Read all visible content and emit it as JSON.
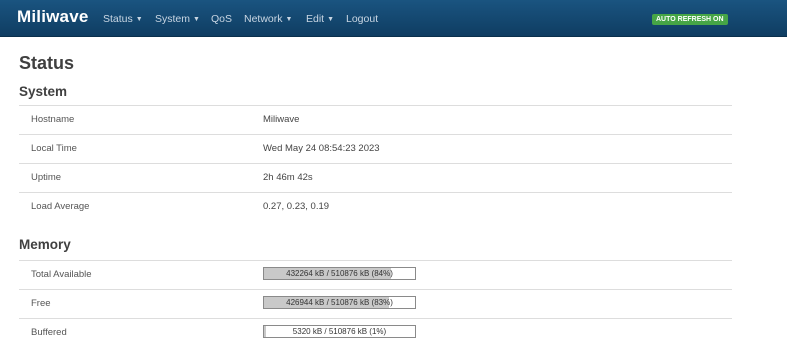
{
  "navbar": {
    "brand": "Miliwave",
    "items": [
      {
        "label": "Status",
        "dropdown": true
      },
      {
        "label": "System",
        "dropdown": true
      },
      {
        "label": "QoS",
        "dropdown": false
      },
      {
        "label": "Network",
        "dropdown": true
      },
      {
        "label": "Edit",
        "dropdown": true
      },
      {
        "label": "Logout",
        "dropdown": false
      }
    ],
    "auto_refresh_label": "AUTO REFRESH ON",
    "auto_refresh_color": "#46a546",
    "background_color": "#13466f"
  },
  "page": {
    "title": "Status"
  },
  "system": {
    "heading": "System",
    "rows": [
      {
        "label": "Hostname",
        "value": "Miliwave"
      },
      {
        "label": "Local Time",
        "value": "Wed May 24 08:54:23 2023"
      },
      {
        "label": "Uptime",
        "value": "2h 46m 42s"
      },
      {
        "label": "Load Average",
        "value": "0.27, 0.23, 0.19"
      }
    ]
  },
  "memory": {
    "heading": "Memory",
    "rows": [
      {
        "label": "Total Available",
        "bar_text": "432264 kB / 510876 kB (84%)",
        "percent": 84
      },
      {
        "label": "Free",
        "bar_text": "426944 kB / 510876 kB (83%)",
        "percent": 83
      },
      {
        "label": "Buffered",
        "bar_text": "5320 kB / 510876 kB (1%)",
        "percent": 1
      }
    ]
  }
}
